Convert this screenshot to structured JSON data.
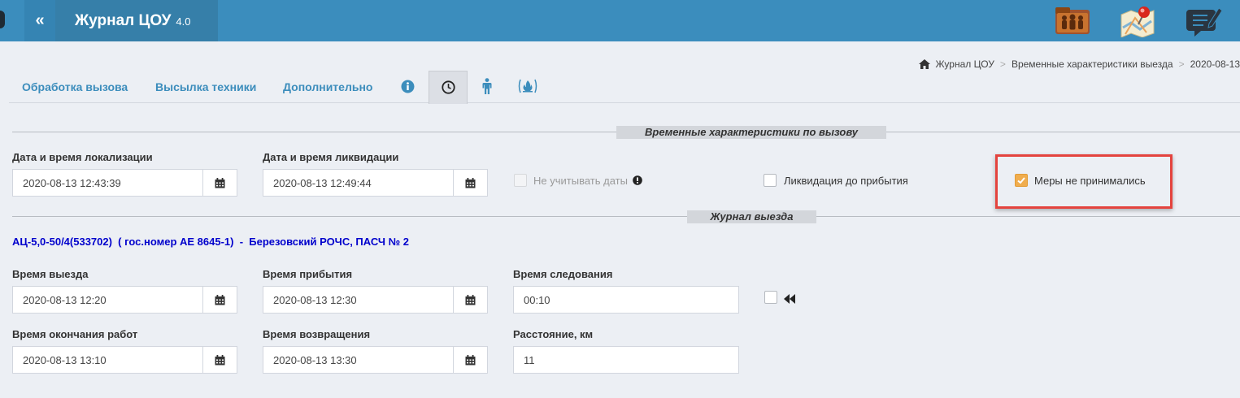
{
  "header": {
    "collapse_glyph": "«",
    "app_name": "Журнал ЦОУ",
    "version": "4.0",
    "icons": [
      "people-folder-icon",
      "map-pin-icon",
      "edit-note-icon"
    ]
  },
  "breadcrumb": {
    "home_icon": "home-icon",
    "items": [
      "Журнал ЦОУ",
      "Временные характеристики выезда",
      "2020-08-13"
    ]
  },
  "tabs": {
    "items": [
      {
        "label": "Обработка вызова"
      },
      {
        "label": "Высылка техники"
      },
      {
        "label": "Дополнительно"
      }
    ],
    "icon_tabs": [
      "info-circle-icon",
      "clock-icon",
      "person-icon",
      "fire-icon"
    ],
    "active": "clock-icon"
  },
  "section_times": {
    "title": "Временные характеристики по вызову",
    "localization_label": "Дата и время локализации",
    "localization_value": "2020-08-13 12:43:39",
    "liquidation_label": "Дата и время ликвидации",
    "liquidation_value": "2020-08-13 12:49:44",
    "ignore_dates_label": "Не учитывать даты",
    "ignore_dates_checked": false,
    "liquidation_before_arrival_label": "Ликвидация до прибытия",
    "liquidation_before_arrival_checked": false,
    "no_measures_label": "Меры не принимались",
    "no_measures_checked": true
  },
  "section_journal": {
    "title": "Журнал выезда",
    "unit": "АЦ-5,0-50/4(533702)  ( гос.номер АЕ 8645-1)  -  Березовский РОЧС, ПАСЧ № 2",
    "departure_label": "Время выезда",
    "departure_value": "2020-08-13 12:20",
    "arrival_label": "Время прибытия",
    "arrival_value": "2020-08-13 12:30",
    "travel_label": "Время следования",
    "travel_value": "00:10",
    "work_end_label": "Время окончания работ",
    "work_end_value": "2020-08-13 13:10",
    "return_label": "Время возвращения",
    "return_value": "2020-08-13 13:30",
    "distance_label": "Расстояние, км",
    "distance_value": "11"
  },
  "colors": {
    "header": "#3b8dbd",
    "tab_text": "#3c8dbc",
    "checkbox_checked": "#f0ad4e",
    "highlight": "#e4433e",
    "unit_text": "#0000cc"
  }
}
